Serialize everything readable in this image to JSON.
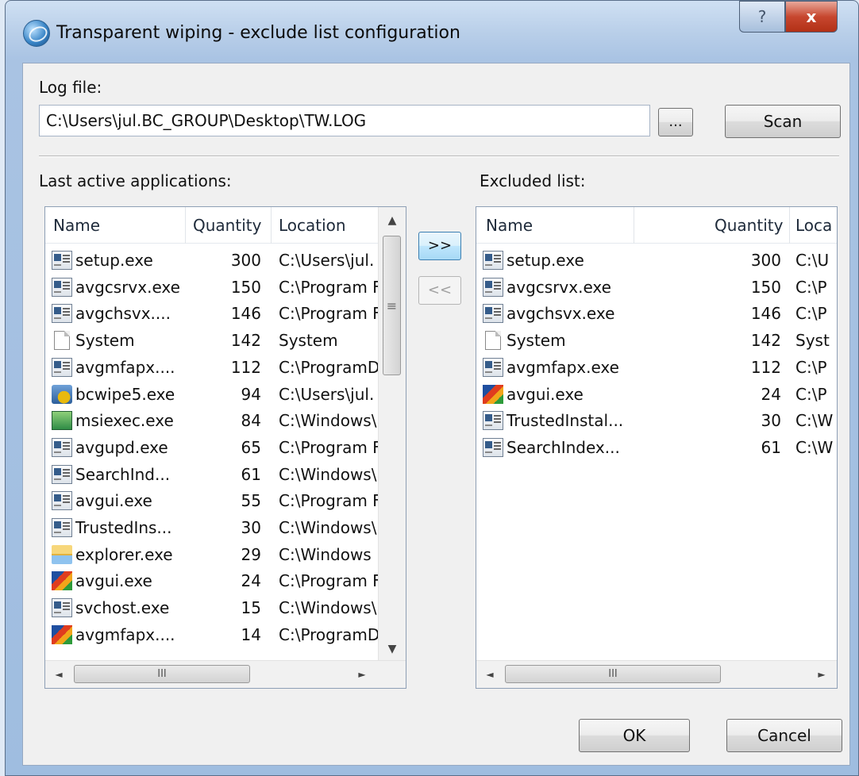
{
  "window": {
    "title": "Transparent wiping - exclude list configuration",
    "help_glyph": "?",
    "close_glyph": "x"
  },
  "log_file": {
    "label": "Log file:",
    "value": "C:\\Users\\jul.BC_GROUP\\Desktop\\TW.LOG",
    "browse_label": "...",
    "scan_label": "Scan"
  },
  "last_active": {
    "label": "Last active applications:",
    "columns": {
      "name": "Name",
      "quantity": "Quantity",
      "location": "Location"
    },
    "rows": [
      {
        "icon": "window-app-icon",
        "name": "setup.exe",
        "quantity": "300",
        "location": "C:\\Users\\jul."
      },
      {
        "icon": "window-app-icon",
        "name": "avgcsrvx.exe",
        "quantity": "150",
        "location": "C:\\Program F"
      },
      {
        "icon": "window-app-icon",
        "name": "avgchsvx....",
        "quantity": "146",
        "location": "C:\\Program F"
      },
      {
        "icon": "document-icon",
        "name": "System",
        "quantity": "142",
        "location": "System"
      },
      {
        "icon": "window-app-icon",
        "name": "avgmfapx....",
        "quantity": "112",
        "location": "C:\\ProgramD"
      },
      {
        "icon": "bcwipe-icon",
        "name": "bcwipe5.exe",
        "quantity": "94",
        "location": "C:\\Users\\jul."
      },
      {
        "icon": "msiexec-icon",
        "name": "msiexec.exe",
        "quantity": "84",
        "location": "C:\\Windows\\"
      },
      {
        "icon": "window-app-icon",
        "name": "avgupd.exe",
        "quantity": "65",
        "location": "C:\\Program F"
      },
      {
        "icon": "window-app-icon",
        "name": "SearchInd...",
        "quantity": "61",
        "location": "C:\\Windows\\"
      },
      {
        "icon": "window-app-icon",
        "name": "avgui.exe",
        "quantity": "55",
        "location": "C:\\Program F"
      },
      {
        "icon": "window-app-icon",
        "name": "TrustedIns...",
        "quantity": "30",
        "location": "C:\\Windows\\"
      },
      {
        "icon": "explorer-icon",
        "name": "explorer.exe",
        "quantity": "29",
        "location": "C:\\Windows"
      },
      {
        "icon": "avg-icon",
        "name": "avgui.exe",
        "quantity": "24",
        "location": "C:\\Program F"
      },
      {
        "icon": "window-app-icon",
        "name": "svchost.exe",
        "quantity": "15",
        "location": "C:\\Windows\\"
      },
      {
        "icon": "avg-icon",
        "name": "avgmfapx....",
        "quantity": "14",
        "location": "C:\\ProgramD"
      }
    ]
  },
  "transfer": {
    "add_label": ">>",
    "remove_label": "<<"
  },
  "excluded": {
    "label": "Excluded list:",
    "columns": {
      "name": "Name",
      "quantity": "Quantity",
      "location": "Loca"
    },
    "rows": [
      {
        "icon": "window-app-icon",
        "name": "setup.exe",
        "quantity": "300",
        "location": "C:\\U"
      },
      {
        "icon": "window-app-icon",
        "name": "avgcsrvx.exe",
        "quantity": "150",
        "location": "C:\\P"
      },
      {
        "icon": "window-app-icon",
        "name": "avgchsvx.exe",
        "quantity": "146",
        "location": "C:\\P"
      },
      {
        "icon": "document-icon",
        "name": "System",
        "quantity": "142",
        "location": "Syst"
      },
      {
        "icon": "window-app-icon",
        "name": "avgmfapx.exe",
        "quantity": "112",
        "location": "C:\\P"
      },
      {
        "icon": "avg-icon",
        "name": "avgui.exe",
        "quantity": "24",
        "location": "C:\\P"
      },
      {
        "icon": "window-app-icon",
        "name": "TrustedInstal...",
        "quantity": "30",
        "location": "C:\\W"
      },
      {
        "icon": "window-app-icon",
        "name": "SearchIndex...",
        "quantity": "61",
        "location": "C:\\W"
      }
    ]
  },
  "scroll": {
    "h_grip": "III",
    "left_arrow": "◄",
    "right_arrow": "►",
    "up_arrow": "▲",
    "down_arrow": "▼",
    "v_grip": "≡"
  },
  "footer": {
    "ok_label": "OK",
    "cancel_label": "Cancel"
  }
}
